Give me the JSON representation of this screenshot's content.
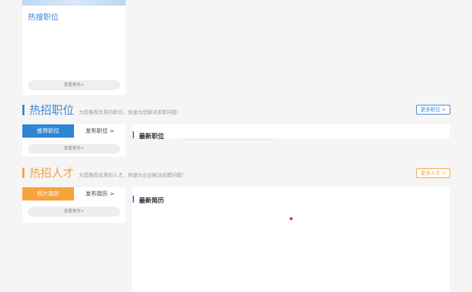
{
  "top_card": {
    "hot_label": "热搜职位",
    "more_label": "查看更多>"
  },
  "jobs_section": {
    "title": "热招职位",
    "subtitle": "为您推荐优质的职位，快速为您解决求职问题！",
    "more_button": "更多职位 >",
    "tab_active": "推荐职位",
    "tab_other": "发布职位 >",
    "more_label": "查看更多>",
    "panel_title": "最新职位",
    "accent_color": "#3a86d6"
  },
  "talent_section": {
    "title": "热招人才",
    "subtitle": "为您推荐优质的人才，快速为企业解决招聘问题！",
    "more_button": "更多人才 >",
    "tab_active": "照片简历",
    "tab_other": "发布简历 >",
    "more_label": "查看更多>",
    "panel_title": "最新简历",
    "accent_color": "#f7a23b"
  }
}
